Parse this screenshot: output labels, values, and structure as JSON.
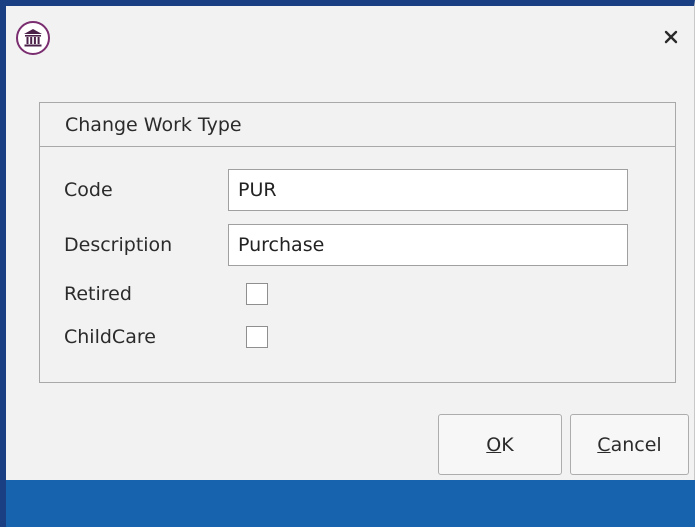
{
  "dialog": {
    "group_title": "Change Work Type",
    "fields": {
      "code_label": "Code",
      "code_value": "PUR",
      "description_label": "Description",
      "description_value": "Purchase",
      "retired_label": "Retired",
      "retired_checked": false,
      "childcare_label": "ChildCare",
      "childcare_checked": false
    },
    "buttons": {
      "ok_access_key": "O",
      "ok_rest": "K",
      "cancel_access_key": "C",
      "cancel_rest": "ancel"
    }
  },
  "icons": {
    "app": "courthouse-icon",
    "close": "close-icon"
  },
  "colors": {
    "accent_border": "#1a3f82",
    "footer_bar": "#1763ad",
    "app_icon_ring": "#7a2d6f"
  }
}
